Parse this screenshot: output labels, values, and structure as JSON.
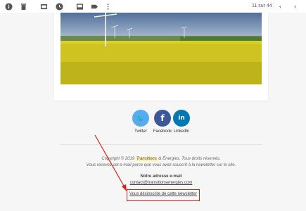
{
  "toolbar": {
    "icons": [
      "info-icon",
      "trash-icon",
      "move-to-folder-icon",
      "clock-icon",
      "label-icon",
      "tag-icon",
      "more-vert-icon"
    ],
    "page_count": "11 sur 44",
    "prev": "‹",
    "next": "›"
  },
  "colors": {
    "twitter": "#55acee",
    "facebook": "#3b5998",
    "linkedin": "#0077b5",
    "annotation_red": "#e0201a"
  },
  "social": {
    "twitter": {
      "glyph": "🐦",
      "label": "Twitter"
    },
    "facebook": {
      "glyph": "f",
      "label": "Facebook"
    },
    "linkedin": {
      "glyph": "in",
      "label": "LinkedIn"
    }
  },
  "footer": {
    "copyright_pre": "Copyright © 2019 ",
    "brand": "Transitions",
    "copyright_post": " & Énergies, Tous droits réservés.",
    "notice": "Vous recevez cet e-mail parce que vous avez souscrit à la newsletter sur le site.",
    "address_title": "Notre adresse e-mail",
    "address_email": "contact@transitionsenergies.com",
    "unsubscribe": "Vous désinscrire de cette newsletter"
  }
}
